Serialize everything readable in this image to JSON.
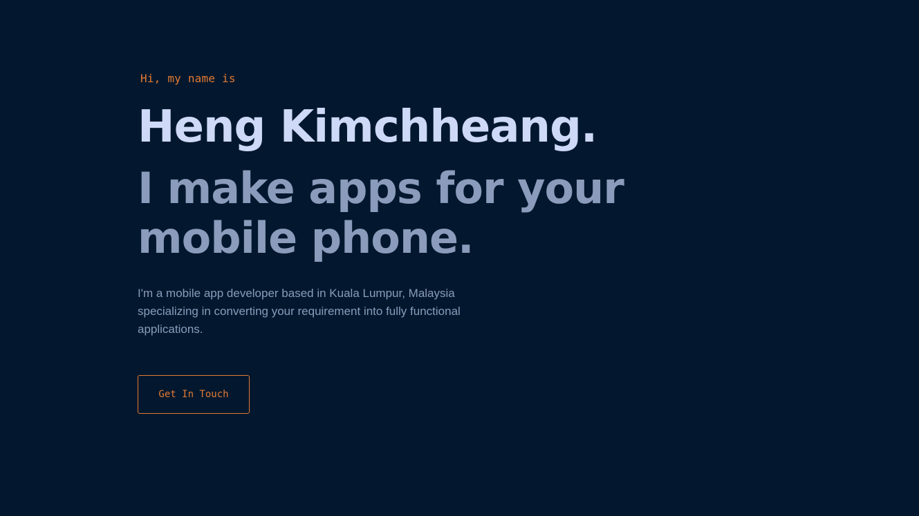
{
  "hero": {
    "greeting": "Hi, my name is",
    "name": "Heng Kimchheang.",
    "tagline": "I make apps for your mobile phone.",
    "bio": "I'm a mobile app developer based in Kuala Lumpur, Malaysia specializing in converting your requirement into fully functional applications.",
    "cta_label": "Get In Touch"
  },
  "colors": {
    "background": "#03182e",
    "accent": "#e37932",
    "name": "#cdd9f7",
    "secondary_text": "#8a9bbb"
  }
}
